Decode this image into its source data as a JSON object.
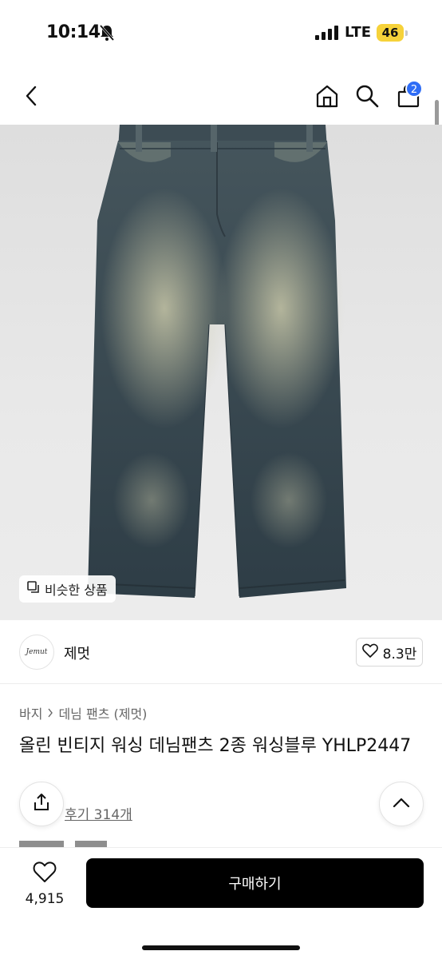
{
  "status_bar": {
    "time": "10:14",
    "network": "LTE",
    "battery": "46",
    "icons": [
      "bell-slash-icon",
      "signal-icon"
    ]
  },
  "nav": {
    "icons": [
      "chevron-left-icon",
      "home-icon",
      "search-icon",
      "shopping-bag-icon"
    ],
    "cart_count": "2"
  },
  "product_image": {
    "alt_subject": "",
    "similar_label": "비슷한 상품"
  },
  "brand": {
    "logo_text": "Jemut",
    "name": "제멋",
    "likes": "8.3만"
  },
  "breadcrumb": {
    "items": [
      "바지",
      "데님 팬츠 (제멋)"
    ]
  },
  "product": {
    "title": "올린 빈티지 워싱 데님팬츠 2종 워싱블루 YHLP2447",
    "review_text": "후기 314개"
  },
  "bottom_bar": {
    "wish_count": "4,915",
    "buy_label": "구매하기"
  },
  "colors": {
    "accent": "#2f6df6",
    "battery": "#f6d23a",
    "buy_button": "#000000"
  }
}
